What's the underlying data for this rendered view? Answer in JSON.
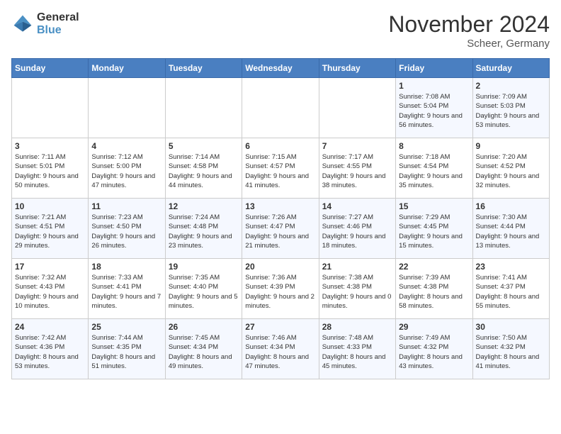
{
  "logo": {
    "line1": "General",
    "line2": "Blue"
  },
  "title": "November 2024",
  "location": "Scheer, Germany",
  "days_header": [
    "Sunday",
    "Monday",
    "Tuesday",
    "Wednesday",
    "Thursday",
    "Friday",
    "Saturday"
  ],
  "weeks": [
    [
      {
        "day": "",
        "info": ""
      },
      {
        "day": "",
        "info": ""
      },
      {
        "day": "",
        "info": ""
      },
      {
        "day": "",
        "info": ""
      },
      {
        "day": "",
        "info": ""
      },
      {
        "day": "1",
        "info": "Sunrise: 7:08 AM\nSunset: 5:04 PM\nDaylight: 9 hours and 56 minutes."
      },
      {
        "day": "2",
        "info": "Sunrise: 7:09 AM\nSunset: 5:03 PM\nDaylight: 9 hours and 53 minutes."
      }
    ],
    [
      {
        "day": "3",
        "info": "Sunrise: 7:11 AM\nSunset: 5:01 PM\nDaylight: 9 hours and 50 minutes."
      },
      {
        "day": "4",
        "info": "Sunrise: 7:12 AM\nSunset: 5:00 PM\nDaylight: 9 hours and 47 minutes."
      },
      {
        "day": "5",
        "info": "Sunrise: 7:14 AM\nSunset: 4:58 PM\nDaylight: 9 hours and 44 minutes."
      },
      {
        "day": "6",
        "info": "Sunrise: 7:15 AM\nSunset: 4:57 PM\nDaylight: 9 hours and 41 minutes."
      },
      {
        "day": "7",
        "info": "Sunrise: 7:17 AM\nSunset: 4:55 PM\nDaylight: 9 hours and 38 minutes."
      },
      {
        "day": "8",
        "info": "Sunrise: 7:18 AM\nSunset: 4:54 PM\nDaylight: 9 hours and 35 minutes."
      },
      {
        "day": "9",
        "info": "Sunrise: 7:20 AM\nSunset: 4:52 PM\nDaylight: 9 hours and 32 minutes."
      }
    ],
    [
      {
        "day": "10",
        "info": "Sunrise: 7:21 AM\nSunset: 4:51 PM\nDaylight: 9 hours and 29 minutes."
      },
      {
        "day": "11",
        "info": "Sunrise: 7:23 AM\nSunset: 4:50 PM\nDaylight: 9 hours and 26 minutes."
      },
      {
        "day": "12",
        "info": "Sunrise: 7:24 AM\nSunset: 4:48 PM\nDaylight: 9 hours and 23 minutes."
      },
      {
        "day": "13",
        "info": "Sunrise: 7:26 AM\nSunset: 4:47 PM\nDaylight: 9 hours and 21 minutes."
      },
      {
        "day": "14",
        "info": "Sunrise: 7:27 AM\nSunset: 4:46 PM\nDaylight: 9 hours and 18 minutes."
      },
      {
        "day": "15",
        "info": "Sunrise: 7:29 AM\nSunset: 4:45 PM\nDaylight: 9 hours and 15 minutes."
      },
      {
        "day": "16",
        "info": "Sunrise: 7:30 AM\nSunset: 4:44 PM\nDaylight: 9 hours and 13 minutes."
      }
    ],
    [
      {
        "day": "17",
        "info": "Sunrise: 7:32 AM\nSunset: 4:43 PM\nDaylight: 9 hours and 10 minutes."
      },
      {
        "day": "18",
        "info": "Sunrise: 7:33 AM\nSunset: 4:41 PM\nDaylight: 9 hours and 7 minutes."
      },
      {
        "day": "19",
        "info": "Sunrise: 7:35 AM\nSunset: 4:40 PM\nDaylight: 9 hours and 5 minutes."
      },
      {
        "day": "20",
        "info": "Sunrise: 7:36 AM\nSunset: 4:39 PM\nDaylight: 9 hours and 2 minutes."
      },
      {
        "day": "21",
        "info": "Sunrise: 7:38 AM\nSunset: 4:38 PM\nDaylight: 9 hours and 0 minutes."
      },
      {
        "day": "22",
        "info": "Sunrise: 7:39 AM\nSunset: 4:38 PM\nDaylight: 8 hours and 58 minutes."
      },
      {
        "day": "23",
        "info": "Sunrise: 7:41 AM\nSunset: 4:37 PM\nDaylight: 8 hours and 55 minutes."
      }
    ],
    [
      {
        "day": "24",
        "info": "Sunrise: 7:42 AM\nSunset: 4:36 PM\nDaylight: 8 hours and 53 minutes."
      },
      {
        "day": "25",
        "info": "Sunrise: 7:44 AM\nSunset: 4:35 PM\nDaylight: 8 hours and 51 minutes."
      },
      {
        "day": "26",
        "info": "Sunrise: 7:45 AM\nSunset: 4:34 PM\nDaylight: 8 hours and 49 minutes."
      },
      {
        "day": "27",
        "info": "Sunrise: 7:46 AM\nSunset: 4:34 PM\nDaylight: 8 hours and 47 minutes."
      },
      {
        "day": "28",
        "info": "Sunrise: 7:48 AM\nSunset: 4:33 PM\nDaylight: 8 hours and 45 minutes."
      },
      {
        "day": "29",
        "info": "Sunrise: 7:49 AM\nSunset: 4:32 PM\nDaylight: 8 hours and 43 minutes."
      },
      {
        "day": "30",
        "info": "Sunrise: 7:50 AM\nSunset: 4:32 PM\nDaylight: 8 hours and 41 minutes."
      }
    ]
  ]
}
